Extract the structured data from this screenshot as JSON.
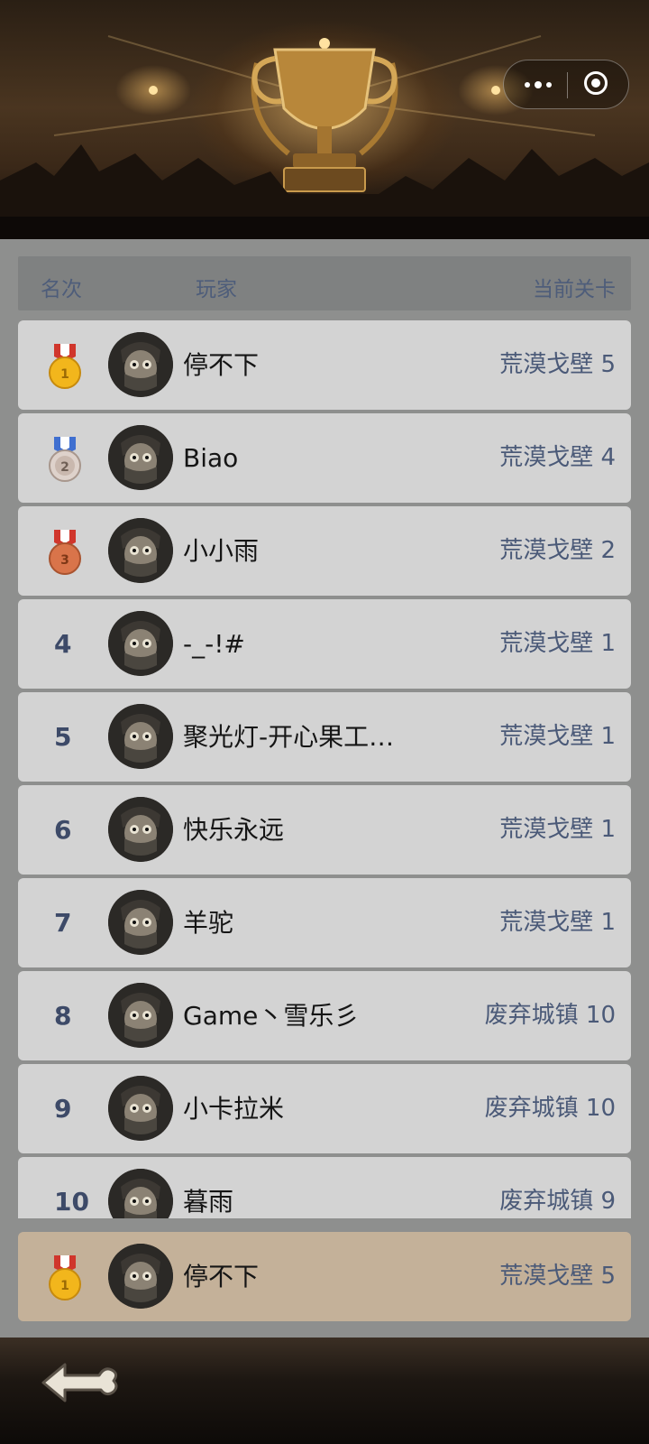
{
  "banner": {
    "icon": "trophy-banner-image"
  },
  "capsule": {
    "more_icon": "more-dots-icon",
    "close_icon": "target-circle-icon"
  },
  "header": {
    "rank": "名次",
    "player": "玩家",
    "level": "当前关卡"
  },
  "rows": [
    {
      "rank": "1",
      "medal": "gold",
      "name": "停不下",
      "level": "荒漠戈壁 5"
    },
    {
      "rank": "2",
      "medal": "silver",
      "name": "Biao",
      "level": "荒漠戈壁 4"
    },
    {
      "rank": "3",
      "medal": "bronze",
      "name": "小小雨",
      "level": "荒漠戈壁 2"
    },
    {
      "rank": "4",
      "name": "-_-!#",
      "level": "荒漠戈壁 1"
    },
    {
      "rank": "5",
      "name": "聚光灯-开心果工…",
      "level": "荒漠戈壁 1"
    },
    {
      "rank": "6",
      "name": "快乐永远",
      "level": "荒漠戈壁 1"
    },
    {
      "rank": "7",
      "name": "羊驼",
      "level": "荒漠戈壁 1"
    },
    {
      "rank": "8",
      "name": "Game丶雪乐彡",
      "level": "废弃城镇 10"
    },
    {
      "rank": "9",
      "name": "小卡拉米",
      "level": "废弃城镇 10"
    },
    {
      "rank": "10",
      "name": "暮雨",
      "level": "废弃城镇 9"
    }
  ],
  "my_rank": {
    "rank": "1",
    "medal": "gold",
    "name": "停不下",
    "level": "荒漠戈壁 5"
  },
  "colors": {
    "gold": "#f2b61c",
    "silver": "#c9b8ae",
    "bronze": "#d9744a",
    "ribbon_red": "#d0362c",
    "ribbon_blue": "#3f6fd0"
  },
  "bottom": {
    "back_icon": "bone-arrow-back-icon"
  }
}
